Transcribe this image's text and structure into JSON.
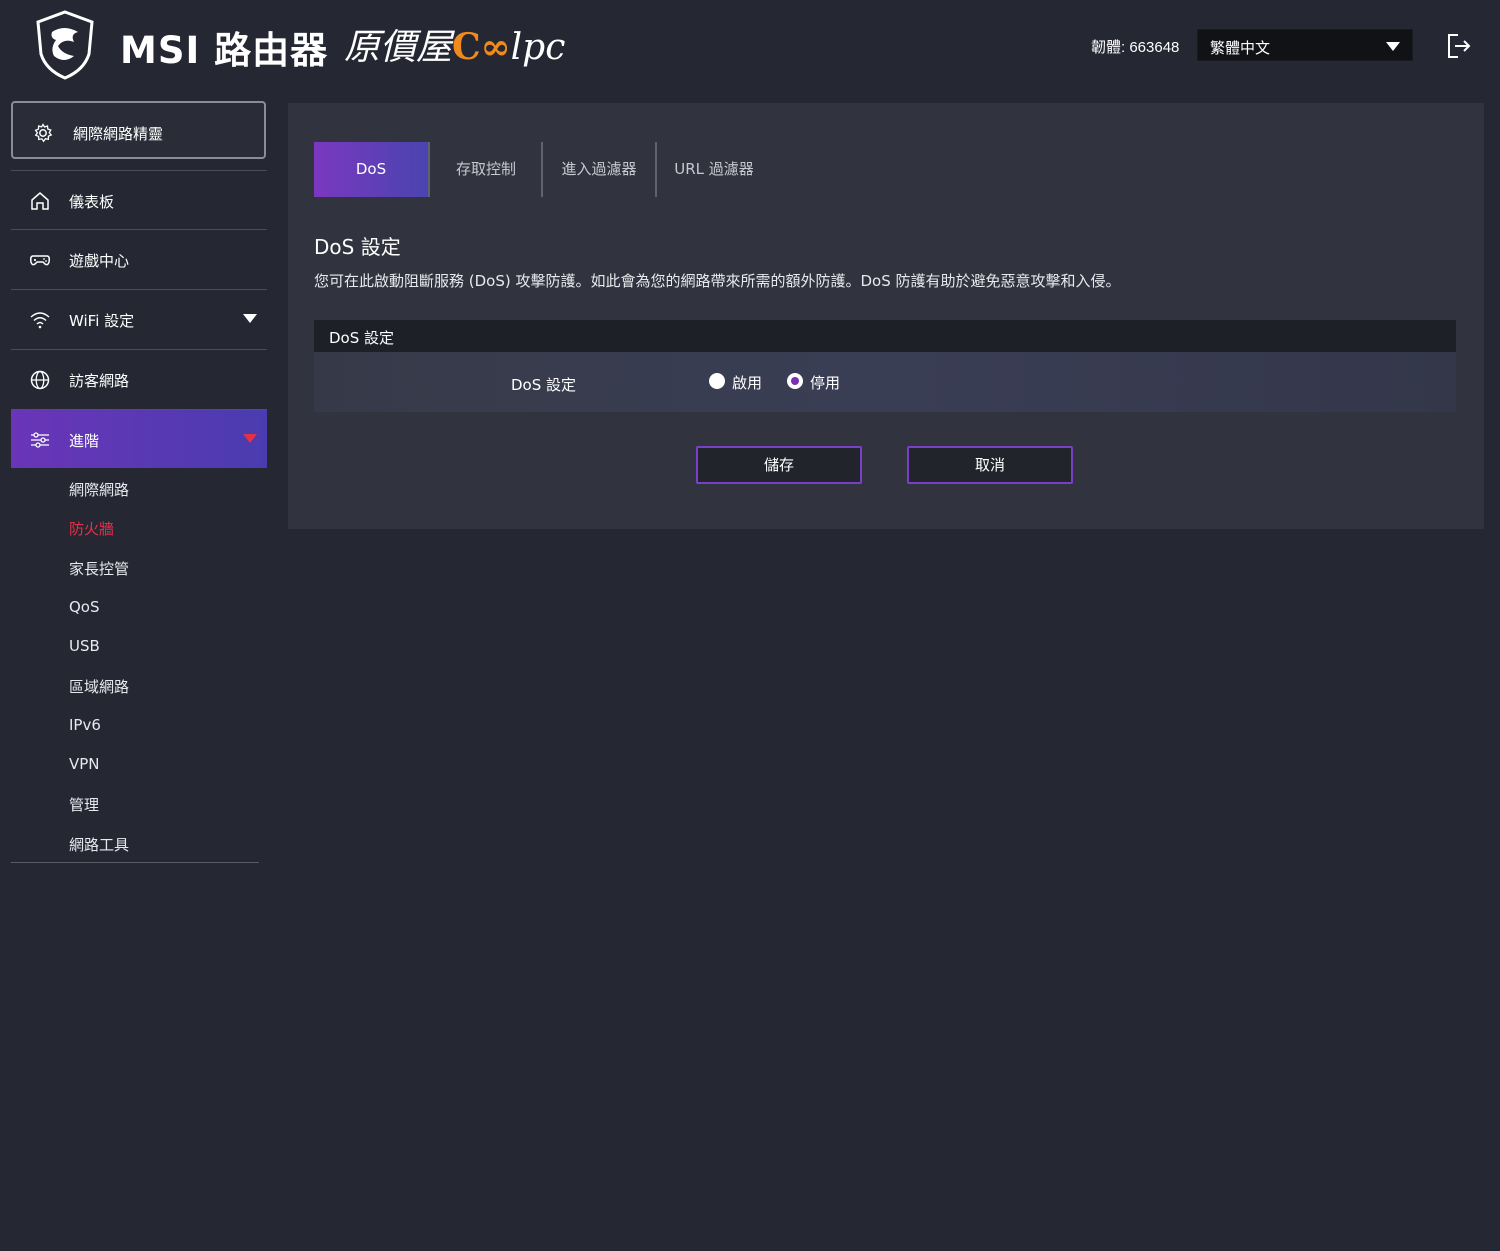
{
  "header": {
    "brand": "MSI 路由器",
    "partner_prefix": "原價屋",
    "partner_c": "C",
    "partner_oo": "∞",
    "partner_suffix": "lpc",
    "firmware": "韌體: 663648",
    "language": "繁體中文"
  },
  "sidebar": {
    "wizard": "網際網路精靈",
    "items": [
      {
        "label": "儀表板",
        "icon": "home-icon"
      },
      {
        "label": "遊戲中心",
        "icon": "gamepad-icon"
      },
      {
        "label": "WiFi 設定",
        "icon": "wifi-icon"
      },
      {
        "label": "訪客網路",
        "icon": "globe-icon"
      },
      {
        "label": "進階",
        "icon": "sliders-icon"
      }
    ],
    "sub_items": [
      "網際網路",
      "防火牆",
      "家長控管",
      "QoS",
      "USB",
      "區域網路",
      "IPv6",
      "VPN",
      "管理",
      "網路工具"
    ]
  },
  "main": {
    "tabs": [
      "DoS",
      "存取控制",
      "進入過濾器",
      "URL 過濾器"
    ],
    "section_title": "DoS 設定",
    "description": "您可在此啟動阻斷服務 (DoS) 攻擊防護。如此會為您的網路帶來所需的額外防護。DoS 防護有助於避免惡意攻擊和入侵。",
    "table_header": "DoS 設定",
    "row_label": "DoS 設定",
    "options": [
      "啟用",
      "停用"
    ],
    "selected_option": "停用",
    "save": "儲存",
    "cancel": "取消"
  },
  "colors": {
    "accent": "#6a35b8",
    "alert": "#e3314a",
    "background": "#252833",
    "panel": "#31343f"
  }
}
